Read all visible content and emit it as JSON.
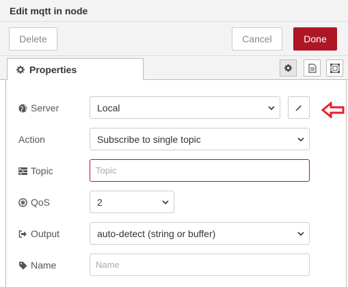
{
  "header": {
    "title": "Edit mqtt in node"
  },
  "toolbar": {
    "delete_label": "Delete",
    "cancel_label": "Cancel",
    "done_label": "Done"
  },
  "tabs": {
    "properties_label": "Properties",
    "icons": [
      "gear-icon",
      "description-icon",
      "appearance-icon"
    ]
  },
  "form": {
    "server": {
      "label": "Server",
      "value": "Local",
      "icon": "globe-icon",
      "edit_icon": "pencil-icon"
    },
    "action": {
      "label": "Action",
      "value": "Subscribe to single topic"
    },
    "topic": {
      "label": "Topic",
      "placeholder": "Topic",
      "icon": "tasks-icon",
      "state": "error"
    },
    "qos": {
      "label": "QoS",
      "value": "2",
      "icon": "qos-icon"
    },
    "output": {
      "label": "Output",
      "value": "auto-detect (string or buffer)",
      "icon": "sign-out-icon"
    },
    "name": {
      "label": "Name",
      "placeholder": "Name",
      "icon": "tag-icon"
    }
  },
  "annotation": {
    "icon": "red-arrow-icon",
    "color": "#e8202a"
  },
  "colors": {
    "primary": "#ad1625",
    "error": "#ad1625",
    "header_bg": "#f3f3f3"
  }
}
